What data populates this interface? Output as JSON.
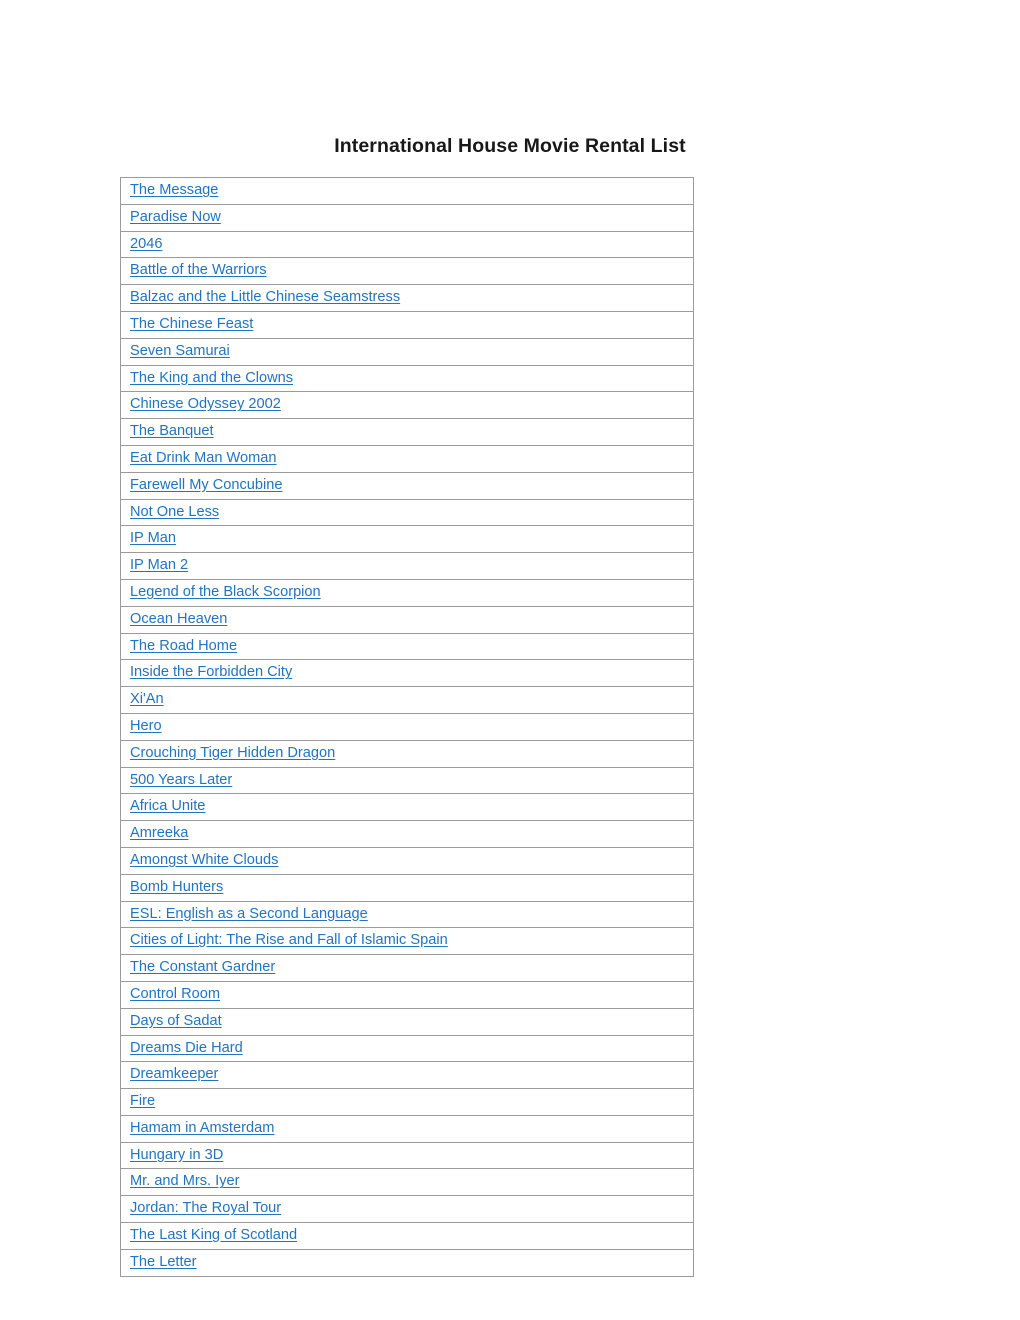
{
  "document": {
    "title": "International House Movie Rental List",
    "background_color": "#ffffff",
    "title_color": "#181818",
    "link_color": "#2274c0",
    "table_border_color": "#9b9b9b"
  },
  "table": {
    "column_count": 1,
    "row_count": 41,
    "rows": [
      {
        "title": "The Message"
      },
      {
        "title": "Paradise Now"
      },
      {
        "title": "2046"
      },
      {
        "title": "Battle of the Warriors"
      },
      {
        "title": "Balzac and the Little Chinese Seamstress"
      },
      {
        "title": "The Chinese Feast"
      },
      {
        "title": "Seven Samurai"
      },
      {
        "title": "The King and the Clowns"
      },
      {
        "title": "Chinese Odyssey 2002"
      },
      {
        "title": "The Banquet"
      },
      {
        "title": "Eat Drink Man Woman"
      },
      {
        "title": "Farewell My Concubine"
      },
      {
        "title": "Not One Less"
      },
      {
        "title": "IP Man"
      },
      {
        "title": "IP Man 2"
      },
      {
        "title": "Legend of the Black Scorpion"
      },
      {
        "title": "Ocean Heaven"
      },
      {
        "title": "The Road Home"
      },
      {
        "title": "Inside the Forbidden City"
      },
      {
        "title": "Xi'An"
      },
      {
        "title": "Hero"
      },
      {
        "title": "Crouching Tiger Hidden Dragon"
      },
      {
        "title": "500 Years Later"
      },
      {
        "title": "Africa Unite"
      },
      {
        "title": "Amreeka"
      },
      {
        "title": "Amongst White Clouds"
      },
      {
        "title": "Bomb Hunters"
      },
      {
        "title": "ESL: English as a Second Language"
      },
      {
        "title": "Cities of Light: The Rise and Fall of Islamic Spain"
      },
      {
        "title": "The Constant Gardner"
      },
      {
        "title": "Control Room"
      },
      {
        "title": "Days of Sadat"
      },
      {
        "title": "Dreams Die Hard"
      },
      {
        "title": "Dreamkeeper"
      },
      {
        "title": "Fire"
      },
      {
        "title": "Hamam in Amsterdam"
      },
      {
        "title": "Hungary in 3D"
      },
      {
        "title": "Mr. and Mrs. Iyer"
      },
      {
        "title": "Jordan: The Royal Tour"
      },
      {
        "title": "The Last King of Scotland"
      },
      {
        "title": "The Letter"
      }
    ]
  }
}
